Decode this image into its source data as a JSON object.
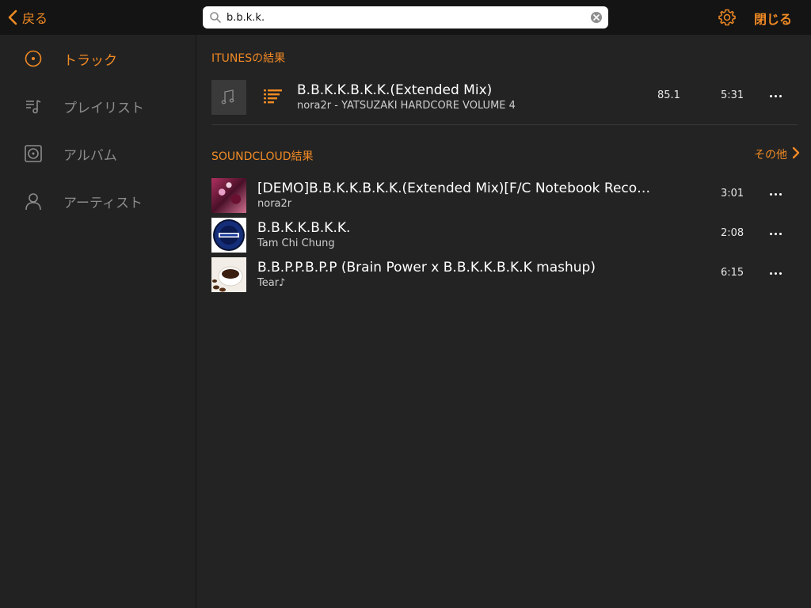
{
  "header": {
    "back_label": "戻る",
    "search_value": "b.b.k.k.",
    "close_label": "閉じる",
    "gear_icon": "gear-icon"
  },
  "sidebar": {
    "items": [
      {
        "label": "トラック",
        "icon": "disc-icon",
        "active": true
      },
      {
        "label": "プレイリスト",
        "icon": "playlist-icon",
        "active": false
      },
      {
        "label": "アルバム",
        "icon": "album-icon",
        "active": false
      },
      {
        "label": "アーティスト",
        "icon": "person-icon",
        "active": false
      }
    ]
  },
  "itunes": {
    "title": "ITUNESの結果",
    "results": [
      {
        "title": "B.B.K.K.B.K.K.(Extended Mix)",
        "subtitle": "nora2r - YATSUZAKI HARDCORE VOLUME 4",
        "bpm": "85.1",
        "duration": "5:31"
      }
    ]
  },
  "soundcloud": {
    "title": "SOUNDCLOUD結果",
    "more_label": "その他",
    "results": [
      {
        "title": "[DEMO]B.B.K.K.B.K.K.(Extended Mix)[F/C Notebook Reco…",
        "subtitle": "nora2r",
        "duration": "3:01"
      },
      {
        "title": "B.B.K.K.B.K.K.",
        "subtitle": "Tam Chi Chung",
        "duration": "2:08"
      },
      {
        "title": "B.B.P.P.B.P.P (Brain Power x B.B.K.K.B.K.K mashup)",
        "subtitle": "Tear♪",
        "duration": "6:15"
      }
    ]
  },
  "colors": {
    "accent": "#f08a24",
    "background": "#232323",
    "topbar": "#141414"
  }
}
